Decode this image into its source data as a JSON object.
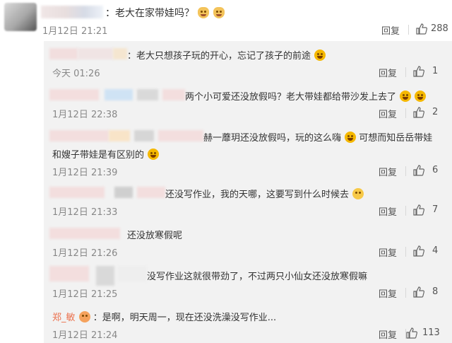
{
  "top_comment": {
    "text": "：老大在家带娃吗？",
    "time": "1月12日 21:21",
    "reply_label": "回复",
    "likes": "288"
  },
  "replies": [
    {
      "text": "：老大只想孩子玩的开心，忘记了孩子的前途",
      "time": "今天 01:26",
      "reply_label": "回复",
      "likes": "1"
    },
    {
      "text": "两个小可爱还没放假吗？老大带娃都给带沙发上去了",
      "time": "1月12日 22:38",
      "reply_label": "回复",
      "likes": "2"
    },
    {
      "text": "赫一蘼玥还没放假吗，玩的这么嗨",
      "text2": "可想而知岳岳带娃",
      "line2": "和嫂子带娃是有区别的",
      "time": "1月12日 21:39",
      "reply_label": "回复",
      "likes": "6"
    },
    {
      "text": "还没写作业，我的天哪，这要写到什么时候去",
      "time": "1月12日 21:33",
      "reply_label": "回复",
      "likes": "7"
    },
    {
      "text": "还没放寒假呢",
      "time": "1月12日 21:26",
      "reply_label": "回复",
      "likes": "4"
    },
    {
      "text": "没写作业这就很带劲了，不过两只小仙女还没放寒假嘛",
      "time": "1月12日 21:25",
      "reply_label": "回复",
      "likes": "8"
    },
    {
      "name": "郑_敏",
      "text": "：是啊，明天周一，现在还没洗澡没写作业...",
      "time": "1月12日 21:24",
      "reply_label": "回复",
      "likes": "113"
    }
  ],
  "icons": {
    "like": "thumbs-up-icon",
    "emoji_laugh": "laughing-emoji-icon",
    "emoji_cat": "cat-emoji-icon"
  },
  "colors": {
    "name_link": "#eb7350",
    "reply_bg": "#f2f2f2",
    "meta": "#888888"
  }
}
